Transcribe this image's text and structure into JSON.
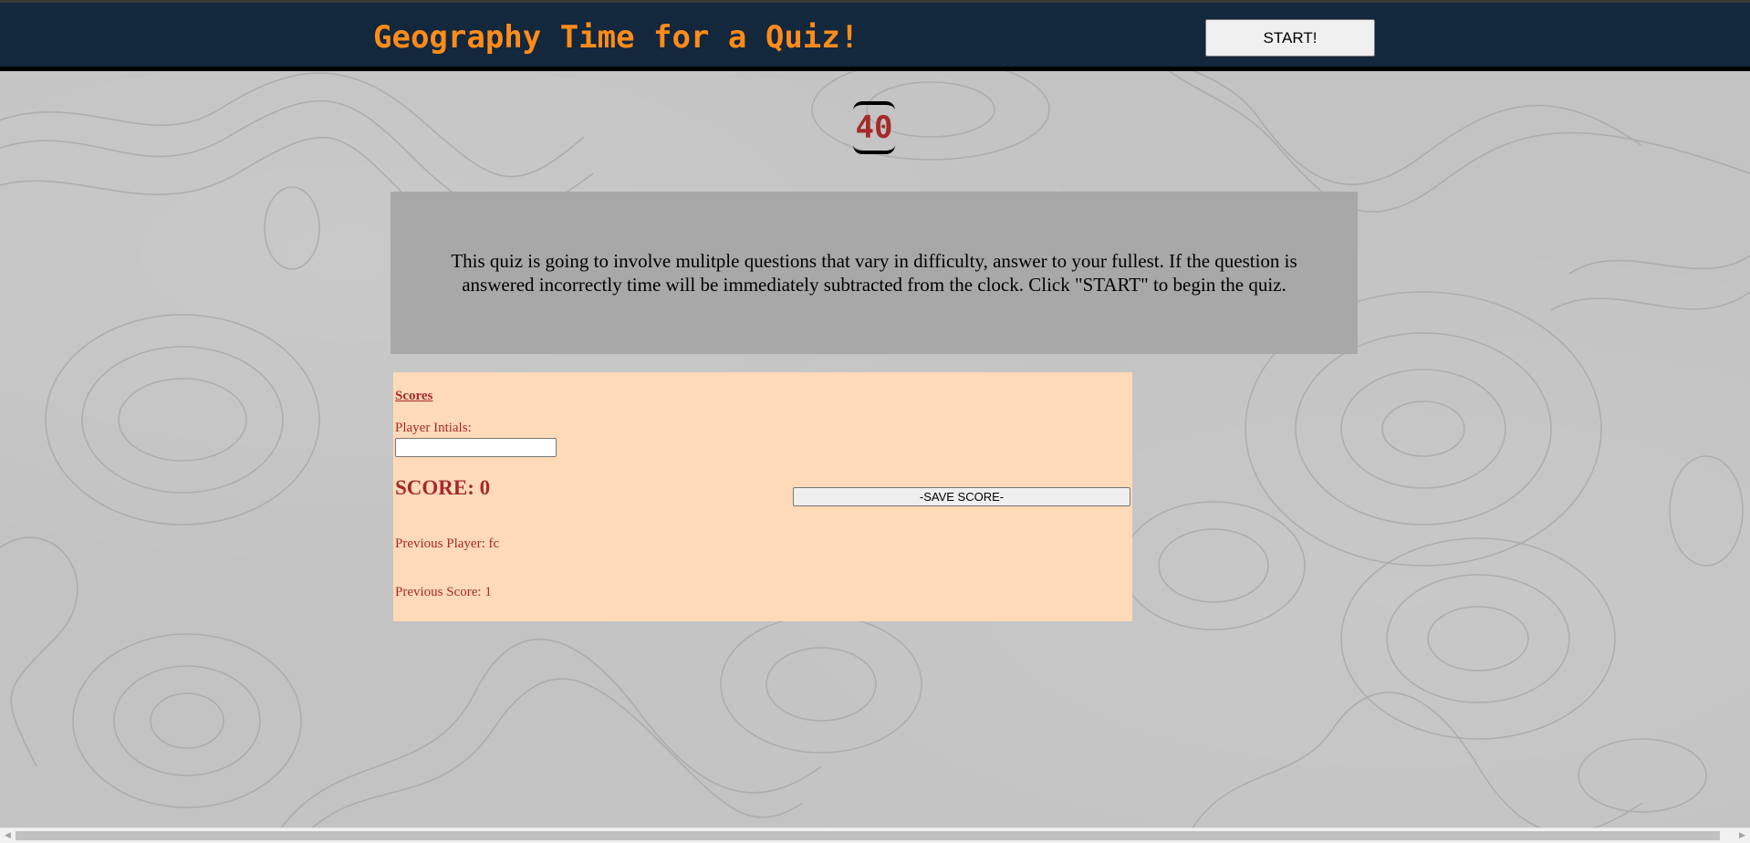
{
  "header": {
    "title": "Geography Time for a Quiz!",
    "start_label": "START!"
  },
  "timer": {
    "value": "40"
  },
  "intro": {
    "text": "This quiz is going to involve mulitple questions that vary in difficulty, answer to your fullest. If the question is answered incorrectly time will be immediately subtracted from the clock. Click \"START\" to begin the quiz."
  },
  "scores": {
    "heading": "Scores",
    "initials_label": "Player Intials:",
    "initials_value": "",
    "score_text": "SCORE: 0",
    "save_label": "-SAVE SCORE-",
    "previous_player": "Previous Player: fc",
    "previous_score": "Previous Score: 1"
  },
  "scrollbar": {
    "left_arrow_icon": "triangle-left-icon",
    "right_arrow_icon": "triangle-right-icon"
  },
  "colors": {
    "header_bg": "#13273d",
    "title": "#ff8c1a",
    "timer_text": "#a52a2a",
    "intro_bg": "#a8a8a8",
    "scores_bg": "#ffdab9",
    "scores_text": "#a52a2a"
  }
}
